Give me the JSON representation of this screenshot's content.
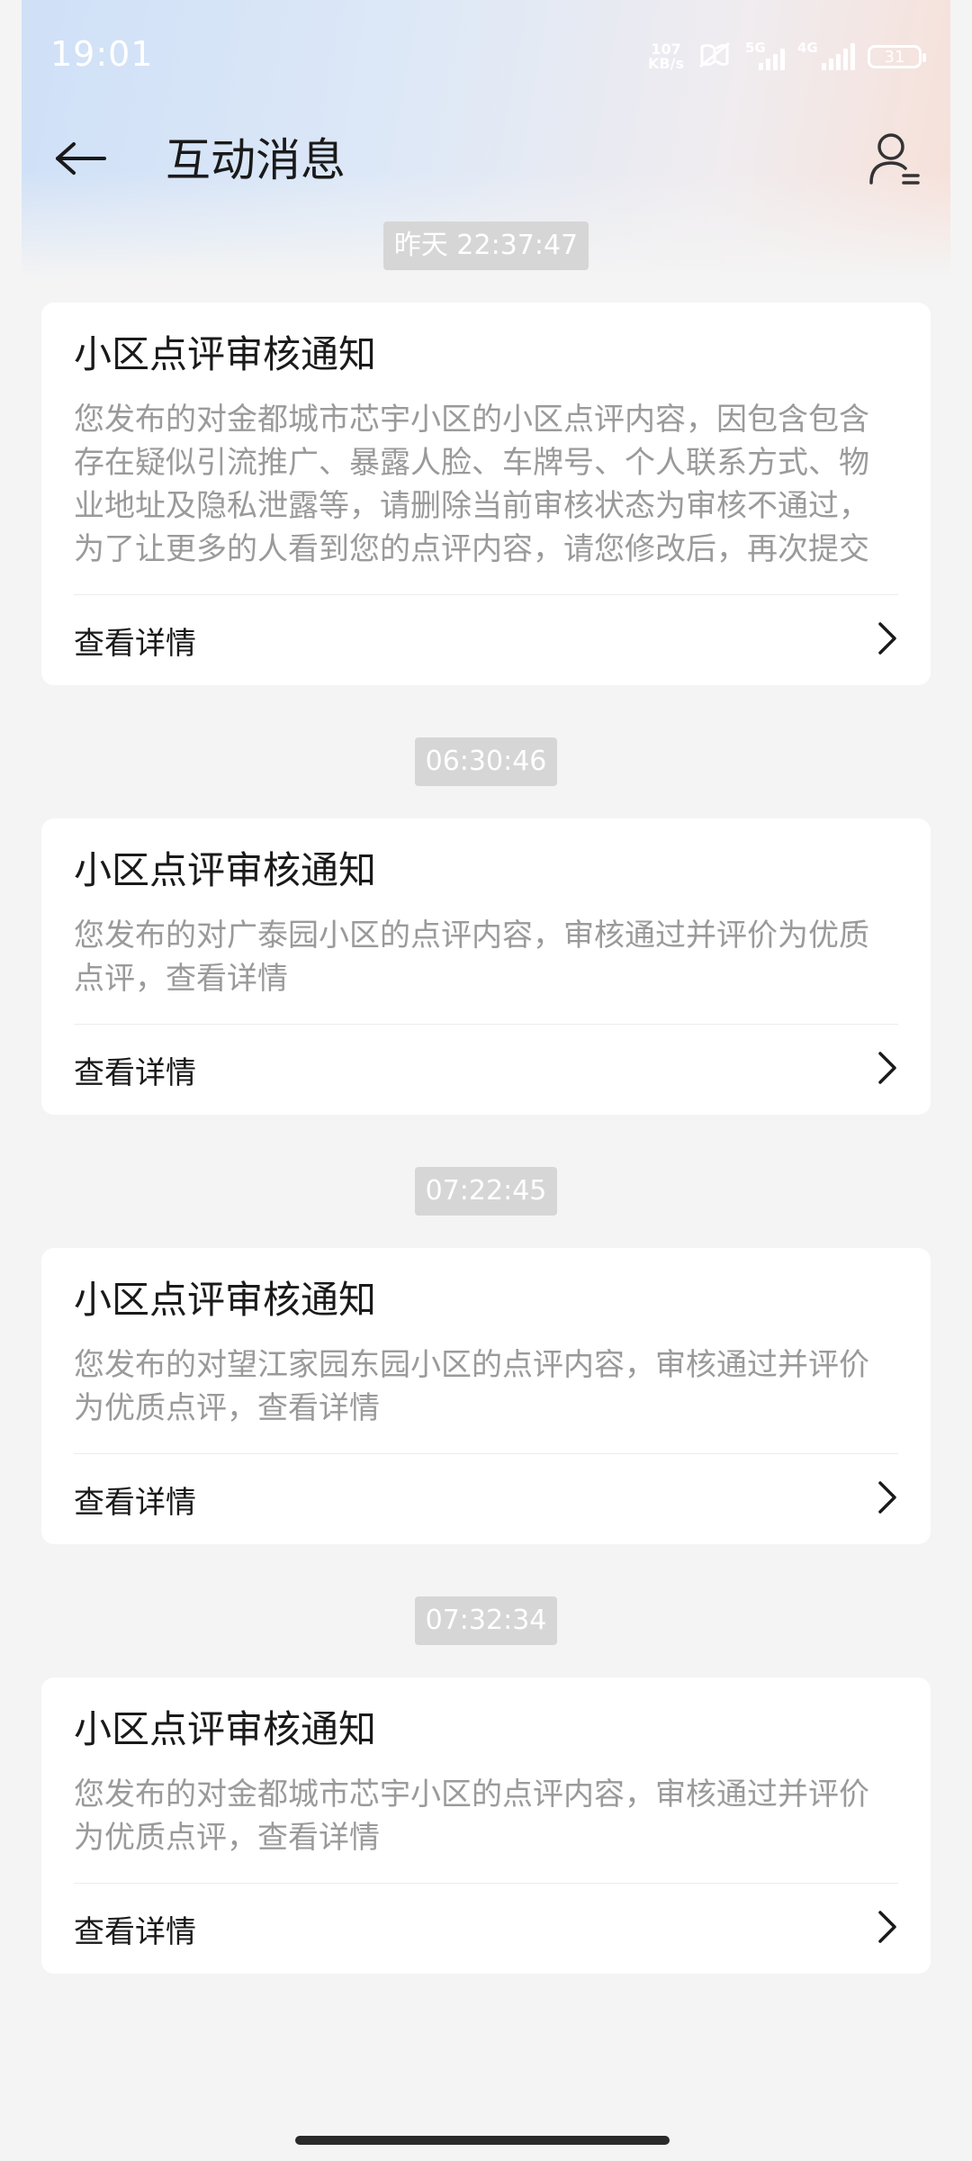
{
  "status_bar": {
    "time": "19:01",
    "net_speed_value": "107",
    "net_speed_unit": "KB/s",
    "sim1_label": "5G",
    "sim2_label": "4G",
    "battery": "31"
  },
  "header": {
    "title": "互动消息"
  },
  "messages": [
    {
      "timestamp": "昨天 22:37:47",
      "title": "小区点评审核通知",
      "body": "您发布的对金都城市芯宇小区的小区点评内容，因包含包含存在疑似引流推广、暴露人脸、车牌号、个人联系方式、物业地址及隐私泄露等，请删除当前审核状态为审核不通过，为了让更多的人看到您的点评内容，请您修改后，再次提交",
      "action": "查看详情"
    },
    {
      "timestamp": "06:30:46",
      "title": "小区点评审核通知",
      "body": "您发布的对广泰园小区的点评内容，审核通过并评价为优质点评，查看详情",
      "action": "查看详情"
    },
    {
      "timestamp": "07:22:45",
      "title": "小区点评审核通知",
      "body": "您发布的对望江家园东园小区的点评内容，审核通过并评价为优质点评，查看详情",
      "action": "查看详情"
    },
    {
      "timestamp": "07:32:34",
      "title": "小区点评审核通知",
      "body": "您发布的对金都城市芯宇小区的点评内容，审核通过并评价为优质点评，查看详情",
      "action": "查看详情"
    }
  ],
  "icons": {
    "back": "arrow-left-icon",
    "profile": "user-list-icon",
    "chevron": "chevron-right-icon"
  },
  "colors": {
    "background": "#f4f4f4",
    "card": "#ffffff",
    "body_text": "#9a9a9a",
    "timestamp_bg": "#d6d6d6"
  }
}
